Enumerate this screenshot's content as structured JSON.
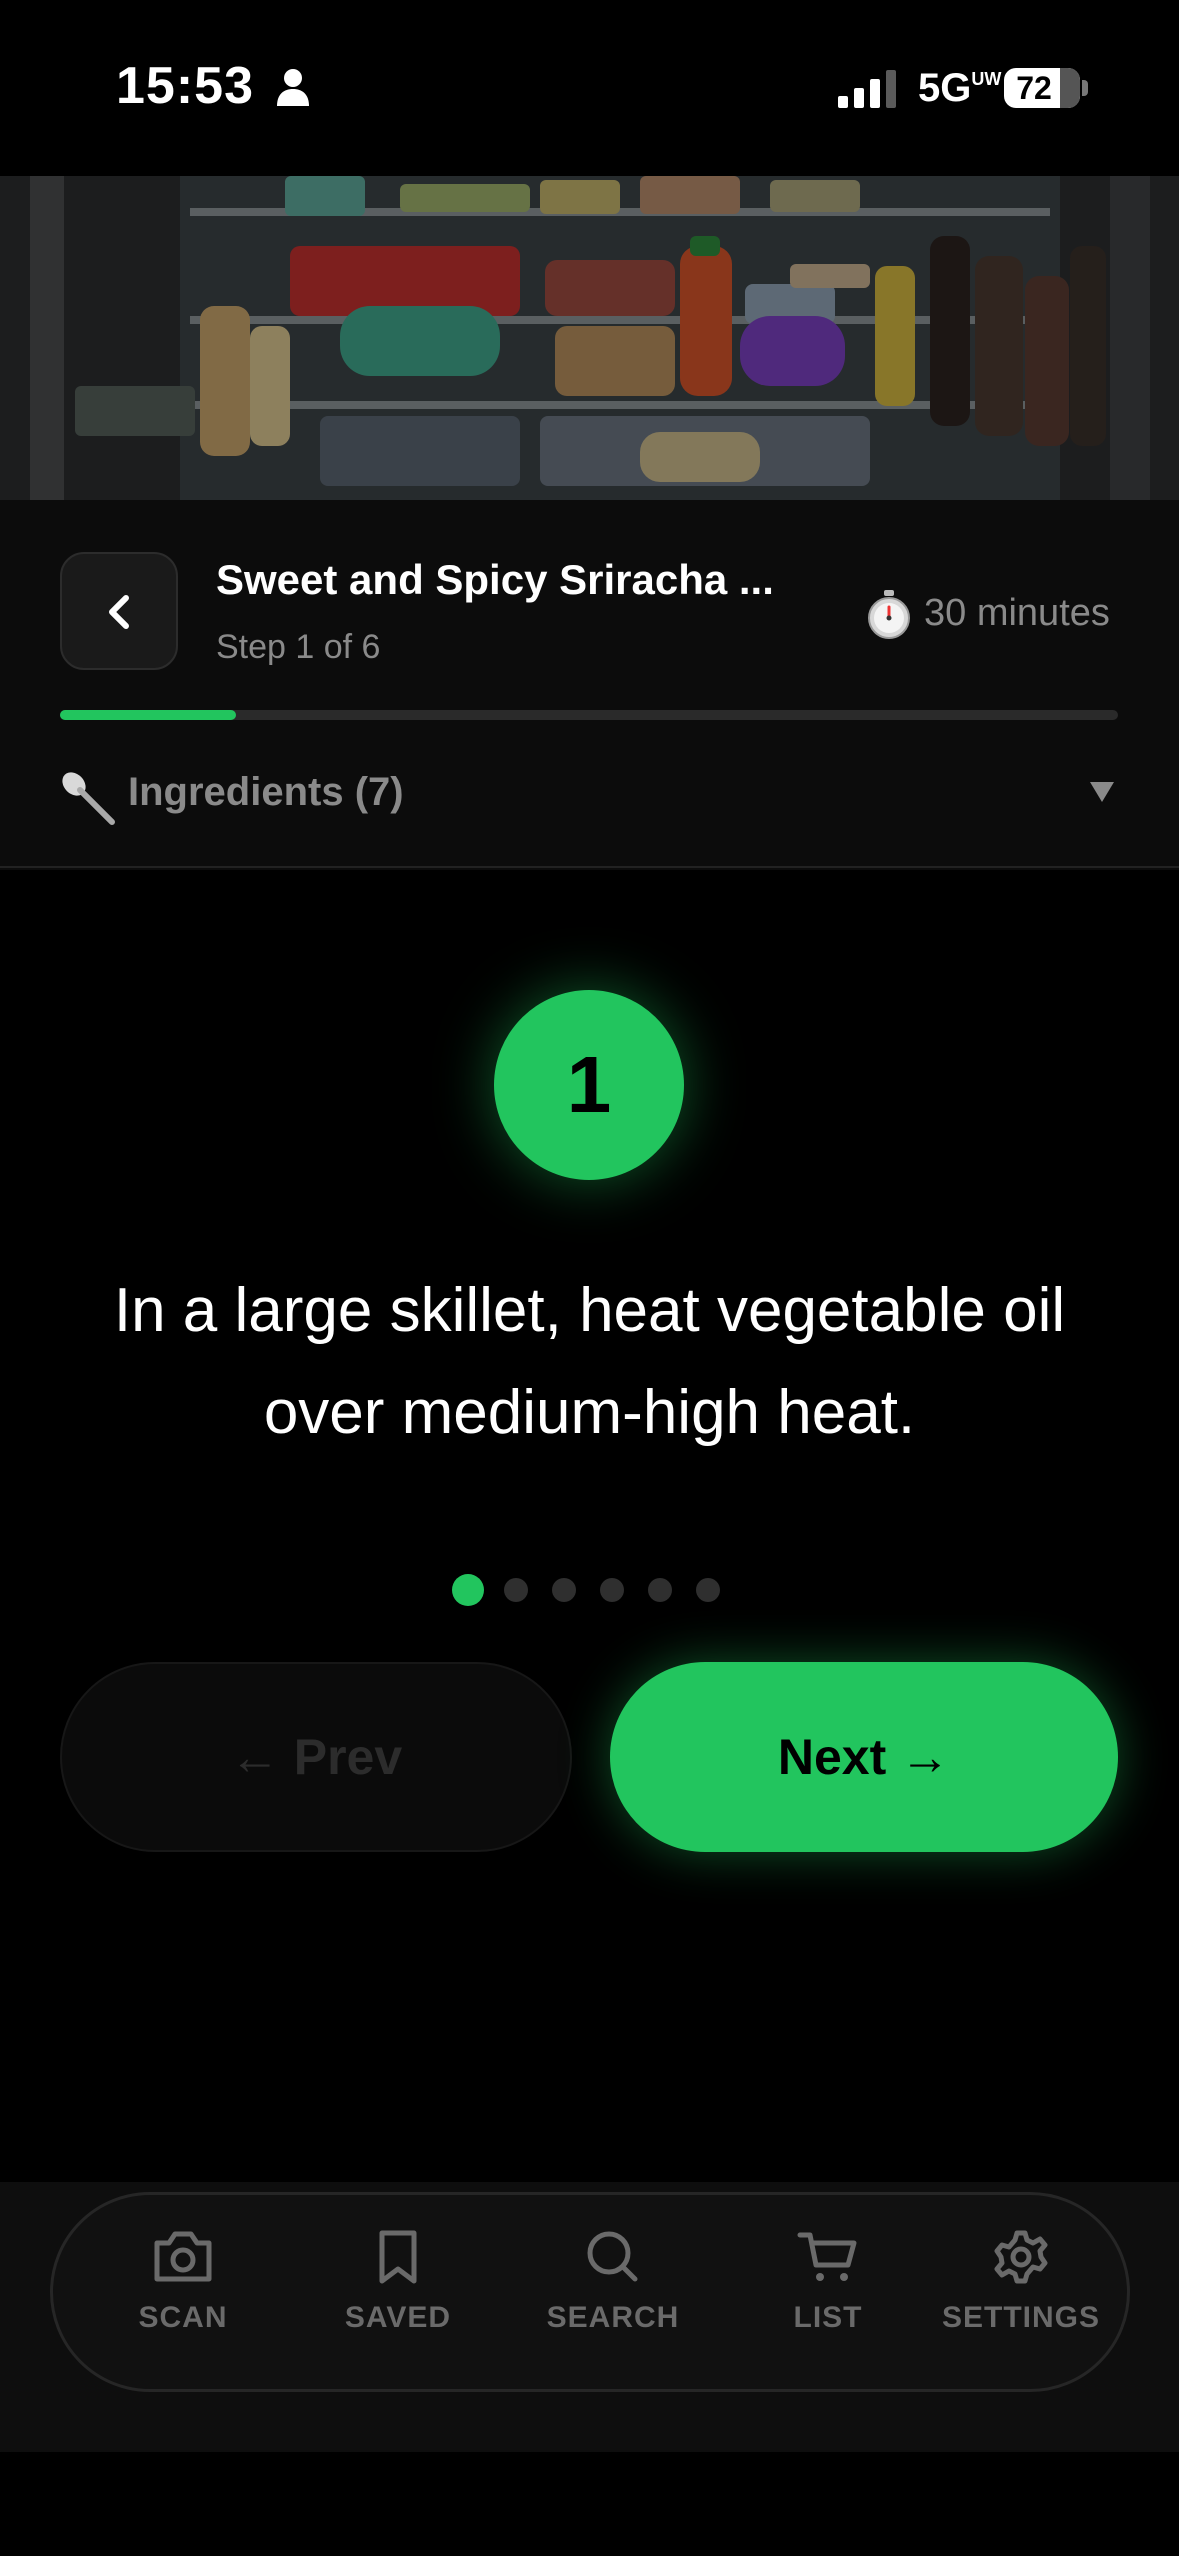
{
  "status_bar": {
    "time": "15:53",
    "network": "5G",
    "network_suffix": "UW",
    "battery": "72"
  },
  "recipe": {
    "title": "Sweet and Spicy Sriracha ...",
    "step_label": "Step 1 of 6",
    "duration": "30 minutes",
    "progress_fraction": 0.1667,
    "ingredients_label": "Ingredients (7)"
  },
  "step": {
    "number": "1",
    "instruction": "In a large skillet, heat vegetable oil over medium-high heat.",
    "total_steps": 6,
    "current_index": 0
  },
  "buttons": {
    "prev": "← Prev",
    "next": "Next →"
  },
  "nav": {
    "items": [
      {
        "label": "SCAN",
        "icon": "camera-icon"
      },
      {
        "label": "SAVED",
        "icon": "bookmark-icon"
      },
      {
        "label": "SEARCH",
        "icon": "search-icon"
      },
      {
        "label": "LIST",
        "icon": "cart-icon"
      },
      {
        "label": "SETTINGS",
        "icon": "gear-icon"
      }
    ]
  },
  "colors": {
    "accent": "#22c55e",
    "background": "#000000",
    "muted_text": "#8a8a8a"
  }
}
